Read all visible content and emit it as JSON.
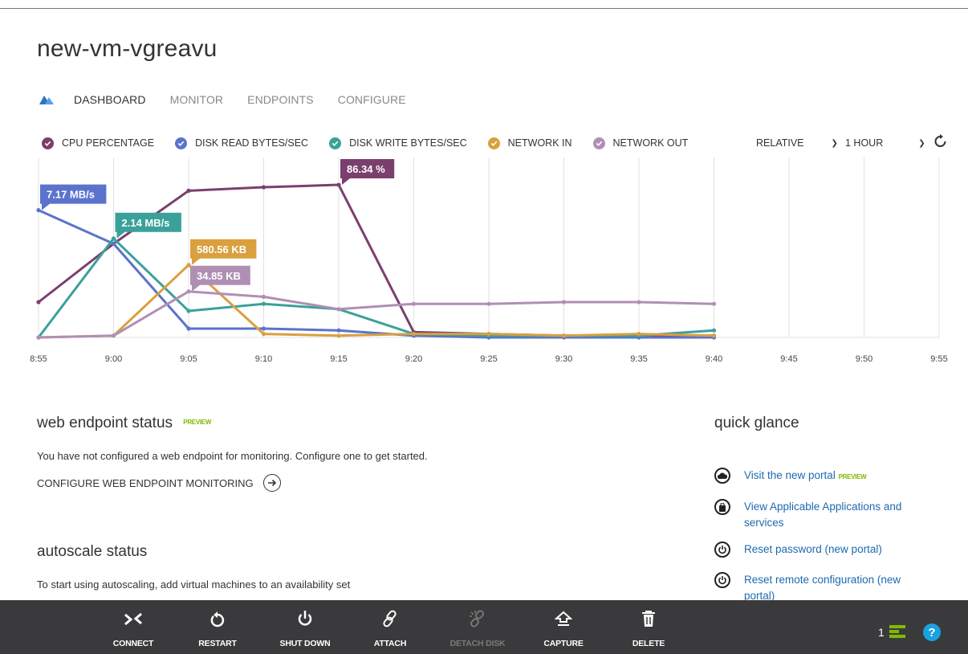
{
  "vm_name": "new-vm-vgreavu",
  "tabs": [
    {
      "label": "DASHBOARD",
      "active": true
    },
    {
      "label": "MONITOR",
      "active": false
    },
    {
      "label": "ENDPOINTS",
      "active": false
    },
    {
      "label": "CONFIGURE",
      "active": false
    }
  ],
  "legend": [
    {
      "label": "CPU PERCENTAGE",
      "color": "#7b3f6e"
    },
    {
      "label": "DISK READ BYTES/SEC",
      "color": "#5b73cc"
    },
    {
      "label": "DISK WRITE BYTES/SEC",
      "color": "#3aa19a"
    },
    {
      "label": "NETWORK IN",
      "color": "#d9a03f"
    },
    {
      "label": "NETWORK OUT",
      "color": "#b08fb5"
    }
  ],
  "controls": {
    "scale": "RELATIVE",
    "range": "1 HOUR"
  },
  "chart_data": {
    "type": "line",
    "x": [
      "8:55",
      "9:00",
      "9:05",
      "9:10",
      "9:15",
      "9:20",
      "9:25",
      "9:30",
      "9:35",
      "9:40",
      "9:45",
      "9:50",
      "9:55"
    ],
    "ylim": [
      0,
      100
    ],
    "grid": true,
    "series": [
      {
        "name": "CPU PERCENTAGE",
        "color": "#7b3f6e",
        "values": [
          20,
          53,
          83,
          85,
          86.34,
          3,
          2,
          1,
          1,
          1,
          null,
          null,
          null
        ]
      },
      {
        "name": "DISK READ BYTES/SEC",
        "color": "#5b73cc",
        "values": [
          72,
          53,
          5,
          5,
          4,
          1,
          0,
          0,
          0,
          0,
          null,
          null,
          null
        ]
      },
      {
        "name": "DISK WRITE BYTES/SEC",
        "color": "#3aa19a",
        "values": [
          0,
          56,
          15,
          19,
          16,
          2,
          1,
          1,
          1,
          4,
          null,
          null,
          null
        ]
      },
      {
        "name": "NETWORK IN",
        "color": "#d9a03f",
        "values": [
          0,
          1,
          41,
          2,
          1,
          2,
          2,
          1,
          2,
          1,
          null,
          null,
          null
        ]
      },
      {
        "name": "NETWORK OUT",
        "color": "#b08fb5",
        "values": [
          0,
          1,
          26,
          23,
          16,
          19,
          19,
          20,
          20,
          19,
          null,
          null,
          null
        ]
      }
    ],
    "callouts": [
      {
        "text": "7.17 MB/s",
        "color": "#5b73cc",
        "x_index": 0,
        "y": 72
      },
      {
        "text": "2.14 MB/s",
        "color": "#3aa19a",
        "x_index": 1,
        "y": 56
      },
      {
        "text": "580.56 KB",
        "color": "#d9a03f",
        "x_index": 2,
        "y": 41
      },
      {
        "text": "34.85 KB",
        "color": "#b08fb5",
        "x_index": 2,
        "y": 26
      },
      {
        "text": "86.34 %",
        "color": "#7b3f6e",
        "x_index": 4,
        "y": 86.34
      }
    ]
  },
  "web_endpoint": {
    "title": "web endpoint status",
    "badge": "PREVIEW",
    "message": "You have not configured a web endpoint for monitoring. Configure one to get started.",
    "link": "CONFIGURE WEB ENDPOINT MONITORING"
  },
  "autoscale": {
    "title": "autoscale status",
    "message": "To start using autoscaling, add virtual machines to an availability set"
  },
  "quick_glance": {
    "title": "quick glance",
    "items": [
      {
        "label": "Visit the new portal",
        "badge": "PREVIEW",
        "icon": "cloud-icon"
      },
      {
        "label": "View Applicable Applications and services",
        "icon": "bag-icon"
      },
      {
        "label": "Reset password (new portal)",
        "icon": "power-icon"
      },
      {
        "label": "Reset remote configuration (new portal)",
        "icon": "power-icon"
      }
    ]
  },
  "commands": [
    {
      "label": "CONNECT",
      "icon": "connect-icon",
      "disabled": false
    },
    {
      "label": "RESTART",
      "icon": "restart-icon",
      "disabled": false
    },
    {
      "label": "SHUT DOWN",
      "icon": "power-icon",
      "disabled": false
    },
    {
      "label": "ATTACH",
      "icon": "link-icon",
      "disabled": false
    },
    {
      "label": "DETACH DISK",
      "icon": "broken-link-icon",
      "disabled": true
    },
    {
      "label": "CAPTURE",
      "icon": "capture-icon",
      "disabled": false
    },
    {
      "label": "DELETE",
      "icon": "trash-icon",
      "disabled": false
    }
  ],
  "notifications": {
    "count": "1"
  },
  "help": {
    "label": "?"
  }
}
